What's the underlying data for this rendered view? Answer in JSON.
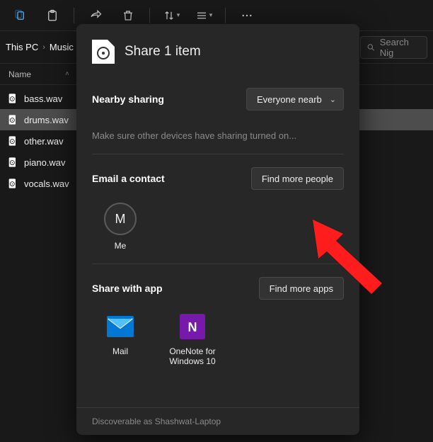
{
  "toolbar": {
    "items": [
      "copy-icon",
      "paste-icon",
      "share-icon",
      "delete-icon",
      "sort-icon",
      "view-icon",
      "more-icon"
    ]
  },
  "breadcrumb": {
    "parts": [
      "This PC",
      "Music"
    ]
  },
  "search": {
    "placeholder": "Search Nig"
  },
  "columns": {
    "name": "Name"
  },
  "files": [
    {
      "name": "bass.wav",
      "selected": false
    },
    {
      "name": "drums.wav",
      "selected": true
    },
    {
      "name": "other.wav",
      "selected": false
    },
    {
      "name": "piano.wav",
      "selected": false
    },
    {
      "name": "vocals.wav",
      "selected": false
    }
  ],
  "share": {
    "title": "Share 1 item",
    "nearby": {
      "label": "Nearby sharing",
      "dropdown": "Everyone nearb",
      "hint": "Make sure other devices have sharing turned on..."
    },
    "email": {
      "label": "Email a contact",
      "button": "Find more people",
      "contacts": [
        {
          "initial": "M",
          "label": "Me"
        }
      ]
    },
    "apps": {
      "label": "Share with app",
      "button": "Find more apps",
      "list": [
        {
          "name": "Mail",
          "color": "#0078d4",
          "kind": "mail"
        },
        {
          "name": "OneNote for Windows 10",
          "color": "#7719aa",
          "kind": "onenote"
        }
      ]
    },
    "footer": "Discoverable as Shashwat-Laptop"
  }
}
